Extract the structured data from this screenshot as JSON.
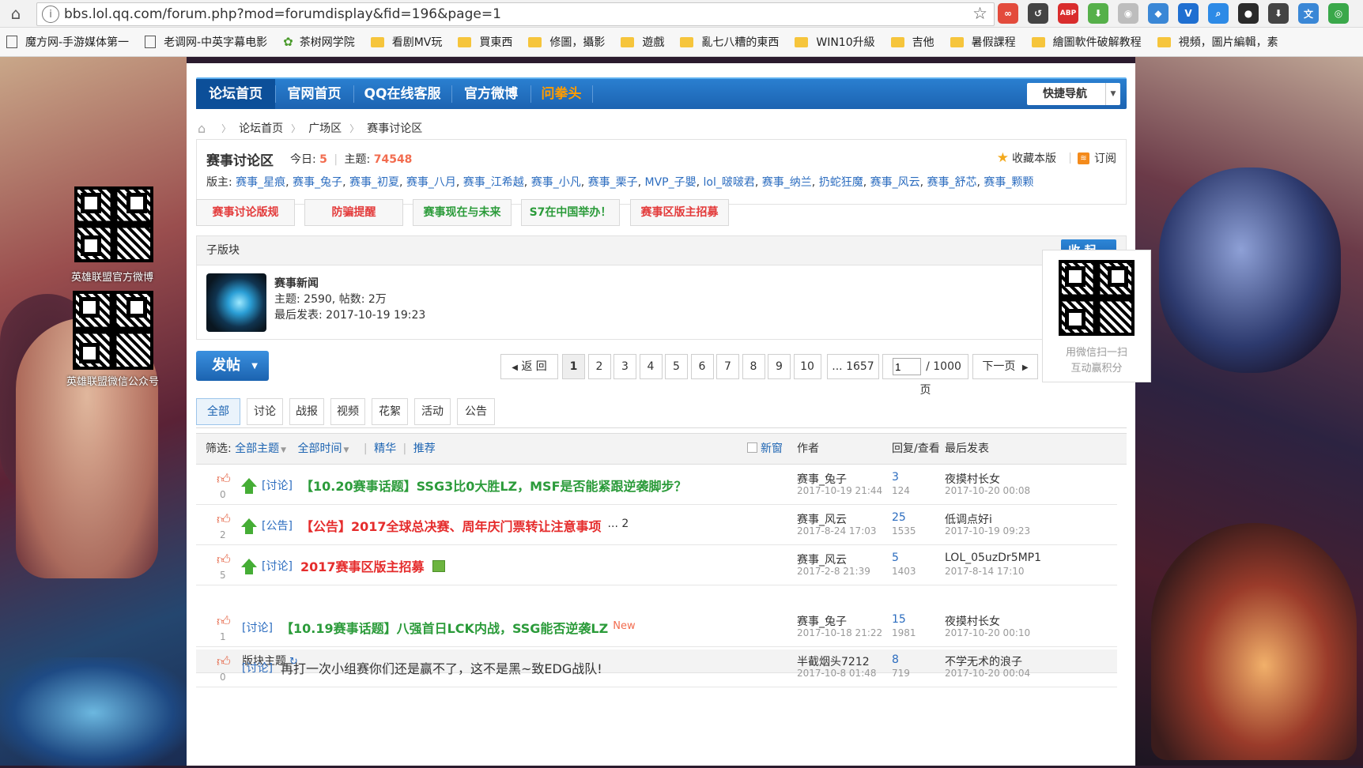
{
  "browser": {
    "url": "bbs.lol.qq.com/forum.php?mod=forumdisplay&fid=196&page=1",
    "extensions": [
      {
        "name": "ext-infinity-icon",
        "color": "#e34b3c",
        "glyph": "∞"
      },
      {
        "name": "ext-refresh-icon",
        "color": "#444444",
        "glyph": "↺"
      },
      {
        "name": "ext-adblock-icon",
        "color": "#d92d2d",
        "glyph": "ABP"
      },
      {
        "name": "ext-download-icon",
        "color": "#56b04a",
        "glyph": "⬇"
      },
      {
        "name": "ext-camera-icon",
        "color": "#bdbdbd",
        "glyph": "◉"
      },
      {
        "name": "ext-chrome-icon",
        "color": "#3a87d6",
        "glyph": "◆"
      },
      {
        "name": "ext-v-icon",
        "color": "#1f6fd1",
        "glyph": "V"
      },
      {
        "name": "ext-search-icon",
        "color": "#2d8ae6",
        "glyph": "⌕"
      },
      {
        "name": "ext-circle-icon",
        "color": "#2a2a2a",
        "glyph": "●"
      },
      {
        "name": "ext-arrow-down-icon",
        "color": "#444444",
        "glyph": "⬇"
      },
      {
        "name": "ext-translate-icon",
        "color": "#3a87d6",
        "glyph": "文"
      },
      {
        "name": "ext-green-icon",
        "color": "#3aa84a",
        "glyph": "◎"
      }
    ]
  },
  "bookmarks": [
    {
      "label": "魔方网-手游媒体第一",
      "icon": "page"
    },
    {
      "label": "老调网-中英字幕电影",
      "icon": "page"
    },
    {
      "label": "茶树网学院",
      "icon": "leaf"
    },
    {
      "label": "看剧MV玩",
      "icon": "folder"
    },
    {
      "label": "買東西",
      "icon": "folder"
    },
    {
      "label": "修圖，攝影",
      "icon": "folder"
    },
    {
      "label": "遊戲",
      "icon": "folder"
    },
    {
      "label": "亂七八糟的東西",
      "icon": "folder"
    },
    {
      "label": "WIN10升級",
      "icon": "folder"
    },
    {
      "label": "吉他",
      "icon": "folder"
    },
    {
      "label": "暑假課程",
      "icon": "folder"
    },
    {
      "label": "繪圖軟件破解教程",
      "icon": "folder"
    },
    {
      "label": "視頻，圖片編輯，素",
      "icon": "folder"
    }
  ],
  "side": {
    "left_qr1_label": "英雄联盟官方微博",
    "left_qr2_label": "英雄联盟微信公众号",
    "right_qr_line1": "用微信扫一扫",
    "right_qr_line2": "互动赢积分"
  },
  "nav": {
    "items": [
      "论坛首页",
      "官网首页",
      "QQ在线客服",
      "官方微博",
      "问拳头"
    ],
    "quick_nav": "快捷导航"
  },
  "breadcrumb": [
    "论坛首页",
    "广场区",
    "赛事讨论区"
  ],
  "board": {
    "title": "赛事讨论区",
    "today_label": "今日:",
    "today_value": "5",
    "topics_label": "主题:",
    "topics_value": "74548",
    "favorite": "收藏本版",
    "subscribe": "订阅",
    "moderators_label": "版主:",
    "moderators": [
      "赛事_星痕",
      "赛事_兔子",
      "赛事_初夏",
      "赛事_八月",
      "赛事_江希越",
      "赛事_小凡",
      "赛事_栗子",
      "MVP_子嬰",
      "lol_啵啵君",
      "赛事_纳兰",
      "扔蛇狂魔",
      "赛事_风云",
      "赛事_舒芯",
      "赛事_颗颗"
    ]
  },
  "tag_buttons": [
    {
      "label": "赛事讨论版规",
      "color": "red"
    },
    {
      "label": "防骗提醒",
      "color": "red"
    },
    {
      "label": "赛事现在与未来",
      "color": "green"
    },
    {
      "label": "S7在中国举办！",
      "color": "green"
    },
    {
      "label": "赛事区版主招募",
      "color": "red"
    }
  ],
  "subforum": {
    "header": "子版块",
    "collapse": "收 起",
    "name": "赛事新闻",
    "stats": "主题: 2590, 帖数: 2万",
    "last_post": "最后发表: 2017-10-19 19:23"
  },
  "pager": {
    "post_button": "发帖",
    "back": "返 回",
    "pages": [
      "1",
      "2",
      "3",
      "4",
      "5",
      "6",
      "7",
      "8",
      "9",
      "10"
    ],
    "current": "1",
    "last": "... 1657",
    "input_value": "1",
    "total": "/ 1000 页",
    "next": "下一页"
  },
  "tabs": [
    "全部",
    "讨论",
    "战报",
    "视频",
    "花絮",
    "活动",
    "公告"
  ],
  "list_header": {
    "filter_label": "筛选:",
    "all_topics": "全部主题",
    "all_time": "全部时间",
    "digest": "精华",
    "recommend": "推荐",
    "new_window": "新窗",
    "author": "作者",
    "replies_views": "回复/查看",
    "last_post": "最后发表"
  },
  "threads_pinned": [
    {
      "likes": "0",
      "category": "[讨论]",
      "title": "【10.20赛事话题】SSG3比0大胜LZ，MSF是否能紧跟逆袭脚步？",
      "style": "green",
      "extra": "",
      "author": "赛事_兔子",
      "date": "2017-10-19 21:44",
      "replies": "3",
      "views": "124",
      "last_user": "夜摸村长女",
      "last_date": "2017-10-20 00:08"
    },
    {
      "likes": "2",
      "category": "[公告]",
      "title": "【公告】2017全球总决赛、周年庆门票转让注意事项",
      "style": "red",
      "extra": "... 2",
      "author": "赛事_风云",
      "date": "2017-8-24 17:03",
      "replies": "25",
      "views": "1535",
      "last_user": "低调点好i",
      "last_date": "2017-10-19 09:23"
    },
    {
      "likes": "5",
      "category": "[讨论]",
      "title": "2017赛事区版主招募",
      "style": "red",
      "extra": "",
      "author": "赛事_风云",
      "date": "2017-2-8 21:39",
      "replies": "5",
      "views": "1403",
      "last_user": "LOL_05uzDr5MP1",
      "last_date": "2017-8-14 17:10"
    }
  ],
  "section_label": "版块主题",
  "threads_normal": [
    {
      "likes": "1",
      "category": "[讨论]",
      "title": "【10.19赛事话题】八强首日LCK内战，SSG能否逆袭LZ",
      "style": "green",
      "new": "New",
      "author": "赛事_兔子",
      "date": "2017-10-18 21:22",
      "replies": "15",
      "views": "1981",
      "last_user": "夜摸村长女",
      "last_date": "2017-10-20 00:10"
    },
    {
      "likes": "0",
      "category": "[讨论]",
      "title": "再打一次小组赛你们还是赢不了，这不是黑~致EDG战队!",
      "style": "plain",
      "new": "",
      "author": "半截烟头7212",
      "date": "2017-10-8 01:48",
      "replies": "8",
      "views": "719",
      "last_user": "不学无术的浪子",
      "last_date": "2017-10-20 00:04"
    }
  ]
}
